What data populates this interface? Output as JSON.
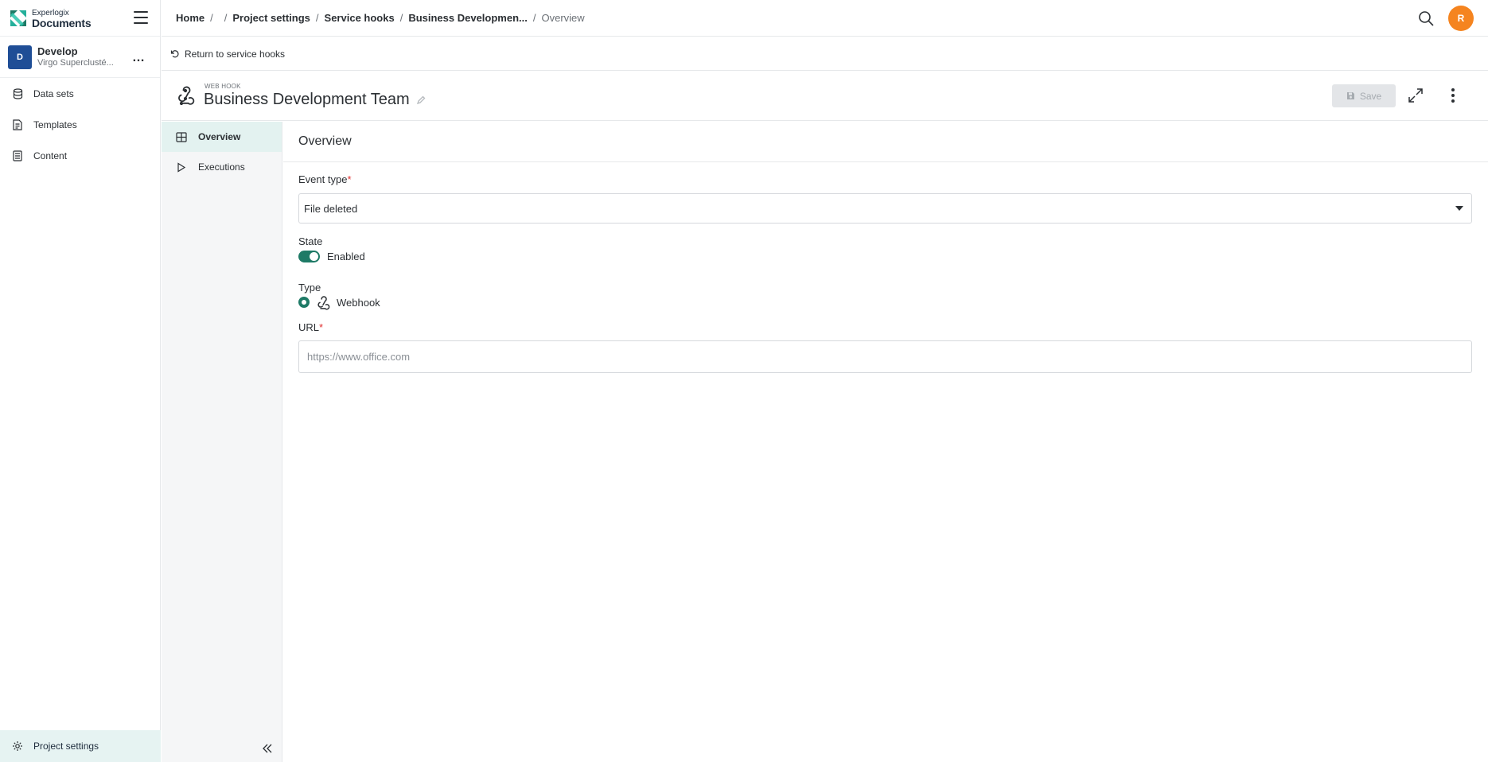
{
  "app": {
    "logo_line1": "Experlogix",
    "logo_line2": "Documents"
  },
  "project": {
    "initial": "D",
    "name": "Develop",
    "subtitle": "Virgo Superclusté...",
    "more": "…"
  },
  "sidebar": {
    "items": [
      {
        "label": "Data sets",
        "icon": "database-icon"
      },
      {
        "label": "Templates",
        "icon": "template-icon"
      },
      {
        "label": "Content",
        "icon": "content-icon"
      }
    ],
    "footer_label": "Project settings"
  },
  "breadcrumb": {
    "home": "Home",
    "sep": "/",
    "project_settings": "Project settings",
    "service_hooks": "Service hooks",
    "hook": "Business Developmen...",
    "current": "Overview"
  },
  "user": {
    "initial": "R",
    "color": "#f5841f"
  },
  "return_link": "Return to service hooks",
  "header": {
    "kicker": "WEB HOOK",
    "title": "Business Development Team",
    "save_label": "Save"
  },
  "subnav": {
    "items": [
      {
        "label": "Overview",
        "active": true
      },
      {
        "label": "Executions",
        "active": false
      }
    ]
  },
  "form": {
    "section_title": "Overview",
    "event_type_label": "Event type",
    "required_mark": "*",
    "event_type_value": "File deleted",
    "state_label": "State",
    "state_value": "Enabled",
    "type_label": "Type",
    "type_value": "Webhook",
    "url_label": "URL",
    "url_placeholder": "https://www.office.com"
  },
  "colors": {
    "accent": "#1e7a66",
    "project_avatar": "#1f4e96",
    "active_bg": "#e3f2f0"
  }
}
